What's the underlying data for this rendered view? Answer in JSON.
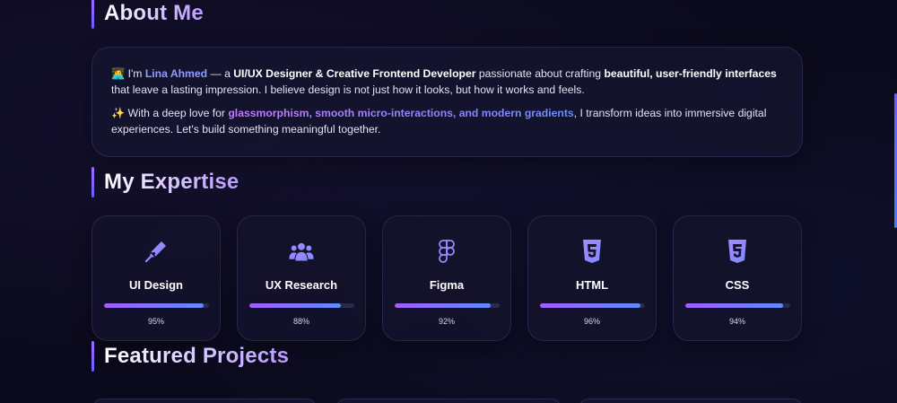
{
  "about": {
    "title": "About Me",
    "p1": {
      "emoji": "👩‍💻",
      "pre": " I'm ",
      "name": "Lina Ahmed",
      "dash": " — a ",
      "role": "UI/UX Designer & Creative Frontend Developer",
      "mid": " passionate about crafting ",
      "highlight": "beautiful, user-friendly interfaces",
      "post": " that leave a lasting impression. I believe design is not just how it looks, but how it works and feels."
    },
    "p2": {
      "emoji": "✨",
      "pre": " With a deep love for ",
      "highlight": "glassmorphism, smooth micro-interactions, and modern gradients",
      "post": ", I transform ideas into immersive digital experiences. Let's build something meaningful together."
    }
  },
  "expertise": {
    "title": "My Expertise",
    "skills": [
      {
        "name": "UI Design",
        "percent": 95,
        "label": "95%",
        "icon": "pen-nib-icon"
      },
      {
        "name": "UX Research",
        "percent": 88,
        "label": "88%",
        "icon": "users-icon"
      },
      {
        "name": "Figma",
        "percent": 92,
        "label": "92%",
        "icon": "figma-icon"
      },
      {
        "name": "HTML",
        "percent": 96,
        "label": "96%",
        "icon": "html5-icon"
      },
      {
        "name": "CSS",
        "percent": 94,
        "label": "94%",
        "icon": "css3-icon"
      }
    ]
  },
  "projects": {
    "title": "Featured Projects"
  },
  "colors": {
    "accent_purple": "#a35dff",
    "accent_blue": "#5d8bff",
    "name_highlight": "#8f9cff",
    "background": "#0b0a1c"
  }
}
